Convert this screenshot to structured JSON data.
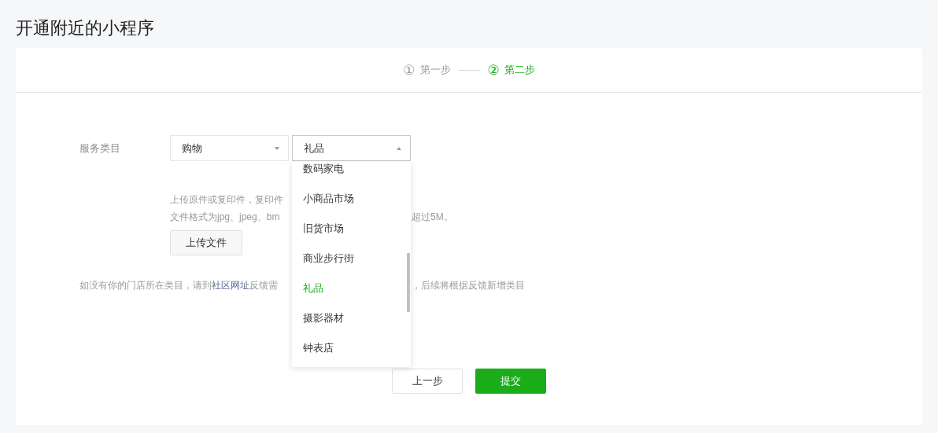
{
  "page_title": "开通附近的小程序",
  "steps": [
    {
      "number": "①",
      "label": "第一步",
      "selected": false
    },
    {
      "number": "②",
      "label": "第二步",
      "selected": true
    }
  ],
  "form": {
    "label": "服务类目",
    "selects": [
      {
        "value": "购物",
        "expanded": false
      },
      {
        "value": "礼品",
        "expanded": true,
        "options": [
          {
            "label": "数码家电",
            "selected": false
          },
          {
            "label": "小商品市场",
            "selected": false
          },
          {
            "label": "旧货市场",
            "selected": false
          },
          {
            "label": "商业步行街",
            "selected": false
          },
          {
            "label": "礼品",
            "selected": true
          },
          {
            "label": "摄影器材",
            "selected": false
          },
          {
            "label": "钟表店",
            "selected": false
          }
        ]
      }
    ],
    "hint_lines": [
      {
        "text": "上传原件或复印件，复印件"
      },
      {
        "text": "文件格式为jpg、jpeg、bm",
        "text_after": "超过5M。"
      }
    ],
    "upload_button": "上传文件",
    "note": {
      "before": "如没有你的门店所在类目，请到",
      "link": "社区网址",
      "after": "反馈需",
      "tail": "，后续将根据反馈新增类目"
    }
  },
  "buttons": [
    {
      "label": "上一步",
      "kind": "secondary"
    },
    {
      "label": "提交",
      "kind": "primary"
    }
  ]
}
